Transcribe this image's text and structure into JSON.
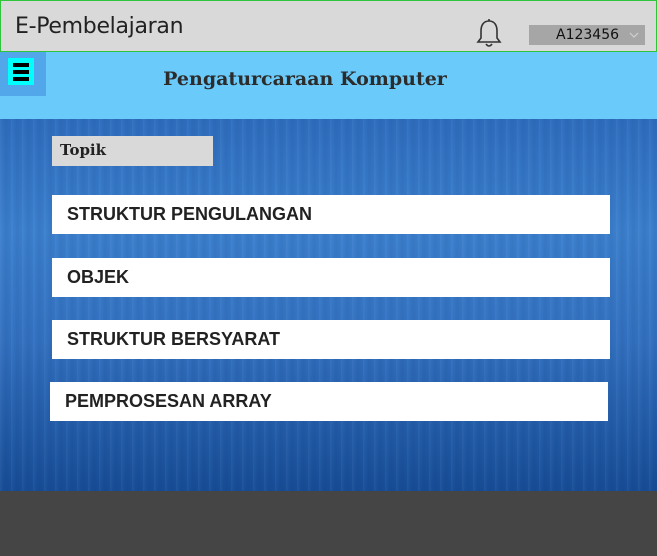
{
  "header": {
    "app_title": "E-Pembelajaran",
    "user_id": "A123456"
  },
  "navbar": {
    "course_title": "Pengaturcaraan Komputer"
  },
  "main": {
    "section_label": "Topik",
    "topics": [
      "STRUKTUR PENGULANGAN",
      "OBJEK",
      "STRUKTUR BERSYARAT",
      "PEMPROSESAN ARRAY"
    ]
  },
  "colors": {
    "accent_green_border": "#2fc43a",
    "nav_background": "#6acbfb",
    "menu_button": "#00ffff",
    "content_blue": "#3270bf",
    "footer_gray": "#454545"
  },
  "icons": [
    "bell-icon",
    "hamburger-menu-icon",
    "chevron-down-icon"
  ]
}
